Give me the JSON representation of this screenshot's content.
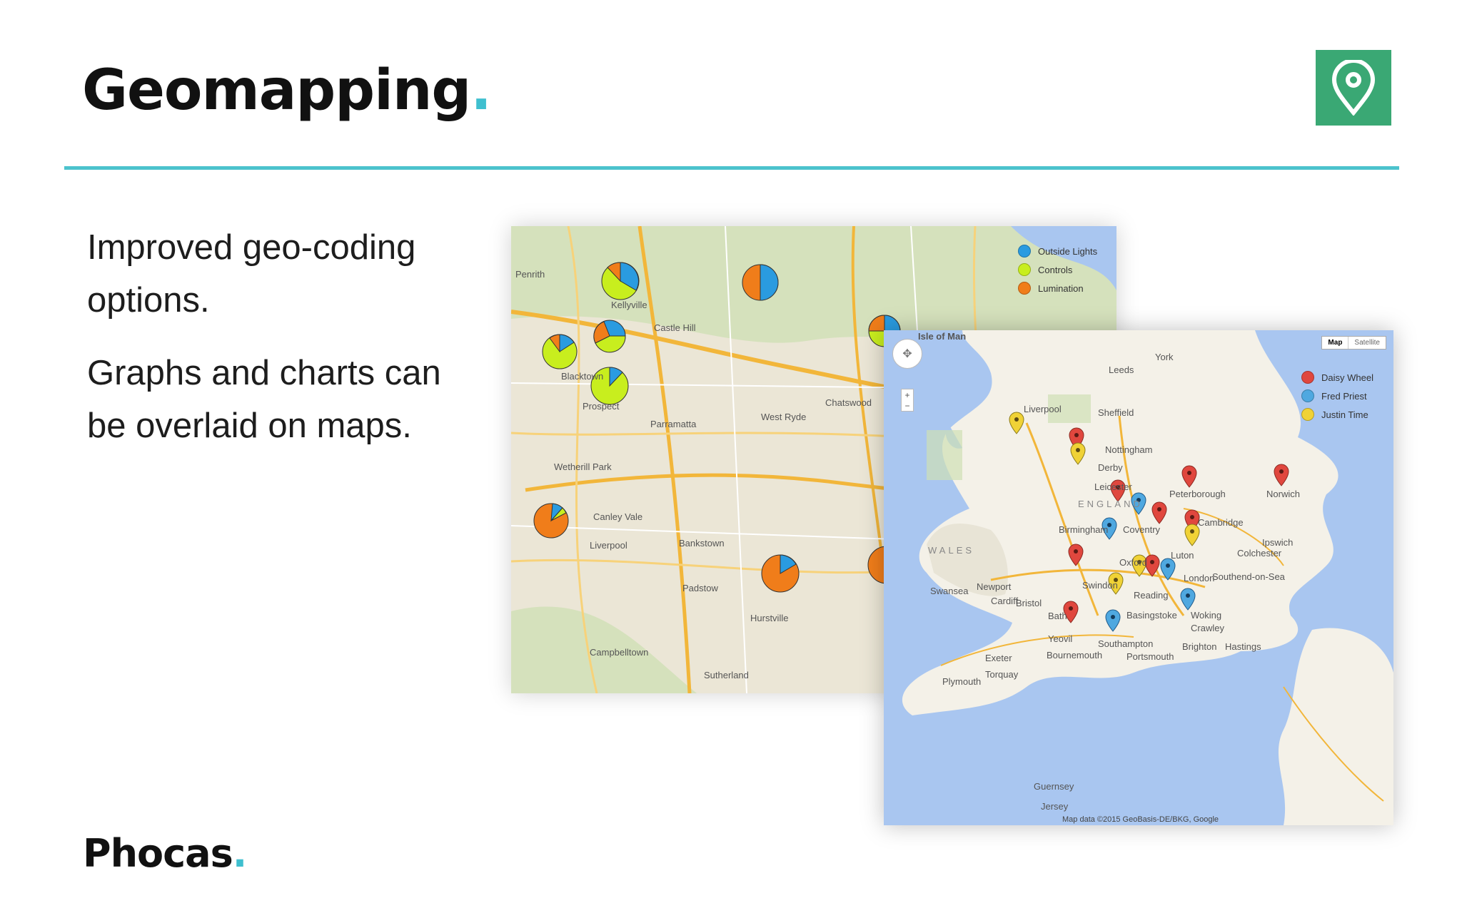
{
  "header": {
    "title": "Geomapping",
    "title_dot": ".",
    "icon": "location-pin-icon",
    "badge_color": "#3aa874",
    "accent_color": "#4cc3cd"
  },
  "content": {
    "paragraphs": [
      "Improved geo-coding options.",
      "Graphs and charts can be overlaid on maps."
    ]
  },
  "footer": {
    "logo_text": "Phocas",
    "logo_dot": "."
  },
  "map_sydney": {
    "legend": [
      {
        "label": "Outside Lights",
        "color": "#2a9be0"
      },
      {
        "label": "Controls",
        "color": "#c8ee1e"
      },
      {
        "label": "Lumination",
        "color": "#f07d1a"
      }
    ],
    "place_labels": [
      "Kellyville",
      "Castle Hill",
      "Blacktown",
      "Parramatta",
      "West Ryde",
      "Chatswood",
      "Bankstown",
      "Hurstville",
      "Sutherland",
      "Liverpool",
      "Campbelltown",
      "Penrith",
      "Prospect",
      "Wetherill Park",
      "Canley Vale",
      "Padstow"
    ]
  },
  "map_uk": {
    "legend": [
      {
        "label": "Daisy Wheel",
        "color": "#e0473e"
      },
      {
        "label": "Fred Priest",
        "color": "#4fa8e0"
      },
      {
        "label": "Justin Time",
        "color": "#f0d236"
      }
    ],
    "map_type_buttons": [
      "Map",
      "Satellite"
    ],
    "place_labels": [
      "Isle of Man",
      "Leeds",
      "York",
      "Liverpool",
      "Sheffield",
      "Nottingham",
      "Derby",
      "Leicester",
      "Peterborough",
      "Norwich",
      "ENGLAND",
      "WALES",
      "Birmingham",
      "Coventry",
      "Cambridge",
      "Ipswich",
      "Colchester",
      "Oxford",
      "Luton",
      "London",
      "Southend-on-Sea",
      "Reading",
      "Swindon",
      "Bristol",
      "Cardiff",
      "Newport",
      "Swansea",
      "Bath",
      "Basingstoke",
      "Woking",
      "Crawley",
      "Southampton",
      "Portsmouth",
      "Brighton",
      "Hastings",
      "Bournemouth",
      "Exeter",
      "Torquay",
      "Plymouth",
      "Yeovil",
      "Guernsey",
      "Jersey"
    ],
    "attribution": "Map data ©2015 GeoBasis-DE/BKG, Google"
  }
}
